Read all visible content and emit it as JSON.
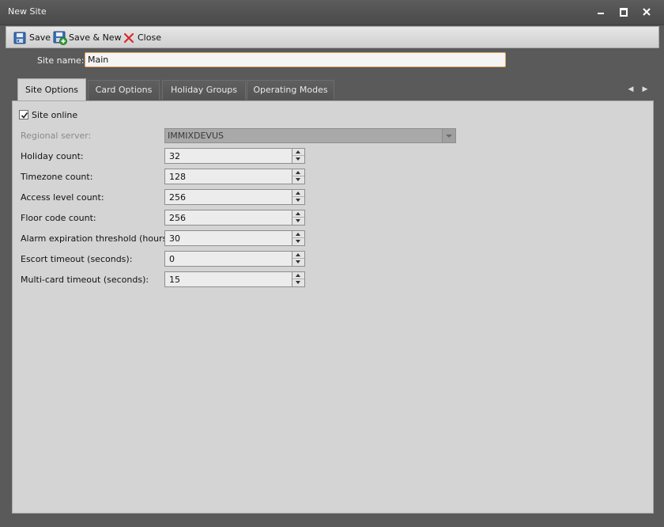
{
  "window": {
    "title": "New Site"
  },
  "toolbar": {
    "save_label": "Save",
    "save_new_label": "Save & New",
    "close_label": "Close"
  },
  "site_name": {
    "label": "Site name:",
    "value": "Main"
  },
  "tabs": [
    {
      "label": "Site Options",
      "active": true
    },
    {
      "label": "Card Options",
      "active": false
    },
    {
      "label": "Holiday Groups",
      "active": false
    },
    {
      "label": "Operating Modes",
      "active": false
    }
  ],
  "site_options": {
    "site_online_label": "Site online",
    "site_online_checked": true,
    "regional_server_label": "Regional server:",
    "regional_server_value": "IMMIXDEVUS",
    "fields": [
      {
        "label": "Holiday count:",
        "value": "32"
      },
      {
        "label": "Timezone count:",
        "value": "128"
      },
      {
        "label": "Access level count:",
        "value": "256"
      },
      {
        "label": "Floor code count:",
        "value": "256"
      },
      {
        "label": "Alarm expiration threshold (hours):",
        "value": "30"
      },
      {
        "label": "Escort timeout (seconds):",
        "value": "0"
      },
      {
        "label": "Multi-card timeout (seconds):",
        "value": "15"
      }
    ]
  },
  "icons": {
    "save": "floppy-disk-icon",
    "save_new": "floppy-disk-plus-icon",
    "close": "red-x-icon",
    "minimize": "minimize-icon",
    "maximize": "maximize-icon",
    "window_close": "close-icon",
    "tab_left": "chevron-left-icon",
    "tab_right": "chevron-right-icon"
  },
  "colors": {
    "titlebar": "#4f4f4f",
    "panel": "#d4d4d4",
    "focus_border": "#e6a35a",
    "close_icon": "#d62b2b"
  }
}
